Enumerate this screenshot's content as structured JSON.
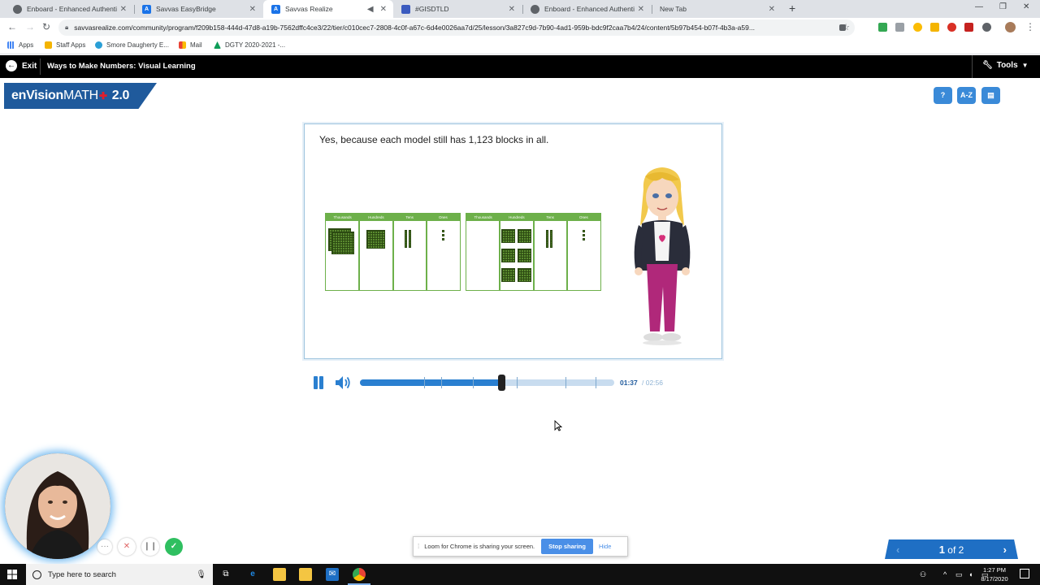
{
  "browser": {
    "tabs": [
      {
        "title": "Enboard - Enhanced Authenticat",
        "icon": "globe-icon",
        "color": "#5f6368"
      },
      {
        "title": "Savvas EasyBridge",
        "icon": "savvas-icon",
        "color": "#1a73e8"
      },
      {
        "title": "Savvas Realize",
        "icon": "savvas-icon",
        "color": "#1a73e8"
      },
      {
        "title": "#GISDTLD",
        "icon": "calendar-icon",
        "color": "#3b5bbf"
      },
      {
        "title": "Enboard - Enhanced Authenticat",
        "icon": "globe-icon",
        "color": "#5f6368"
      },
      {
        "title": "New Tab",
        "icon": "",
        "color": ""
      }
    ],
    "active_tab": 2,
    "url": "savvasrealize.com/community/program/f209b158-444d-47d8-a19b-7562dffc4ce3/22/tier/c010cec7-2808-4c0f-a67c-6d4e0026aa7d/25/lesson/3a827c9d-7b90-4ad1-959b-bdc9f2caa7b4/24/content/5b97b454-b07f-4b3a-a59...",
    "bookmarks": [
      {
        "label": "Apps",
        "color": "#4285f4"
      },
      {
        "label": "Staff Apps",
        "color": "#f4b400"
      },
      {
        "label": "Smore Daugherty E...",
        "color": "#2a9fd6"
      },
      {
        "label": "Mail",
        "color": "#ea4335"
      },
      {
        "label": "DGTY 2020-2021 -...",
        "color": "#0f9d58"
      }
    ]
  },
  "app": {
    "exit_label": "Exit",
    "lesson_title": "Ways to Make Numbers: Visual Learning",
    "tools_label": "Tools",
    "logo_text": "enVision",
    "logo_math": "MATH",
    "logo_version": "2.0",
    "tool_icons": [
      "search-help-icon",
      "glossary-icon",
      "print-icon"
    ],
    "glossary_label": "A-Z"
  },
  "slide": {
    "caption": "Yes, because each model still has 1,123 blocks in all.",
    "place_value_headers": [
      "Thousands",
      "Hundreds",
      "Tens",
      "Ones"
    ],
    "model_a": {
      "thousands": 1,
      "hundreds": 1,
      "tens": 2,
      "ones": 3
    },
    "model_b": {
      "thousands": 0,
      "hundreds": 11,
      "tens": 2,
      "ones": 3
    }
  },
  "player": {
    "current_time": "01:37",
    "total_time": "/ 02:56",
    "progress_fraction": 0.551,
    "chapter_marks": [
      0.253,
      0.318,
      0.445,
      0.618,
      0.808,
      0.925
    ]
  },
  "loom": {
    "banner_message": "Loom for Chrome is sharing your screen.",
    "stop_label": "Stop sharing",
    "hide_label": "Hide"
  },
  "pager": {
    "current": "1",
    "separator": "of",
    "total": "2"
  },
  "taskbar": {
    "search_placeholder": "Type here to search",
    "time": "1:27 PM",
    "date": "8/17/2020"
  }
}
